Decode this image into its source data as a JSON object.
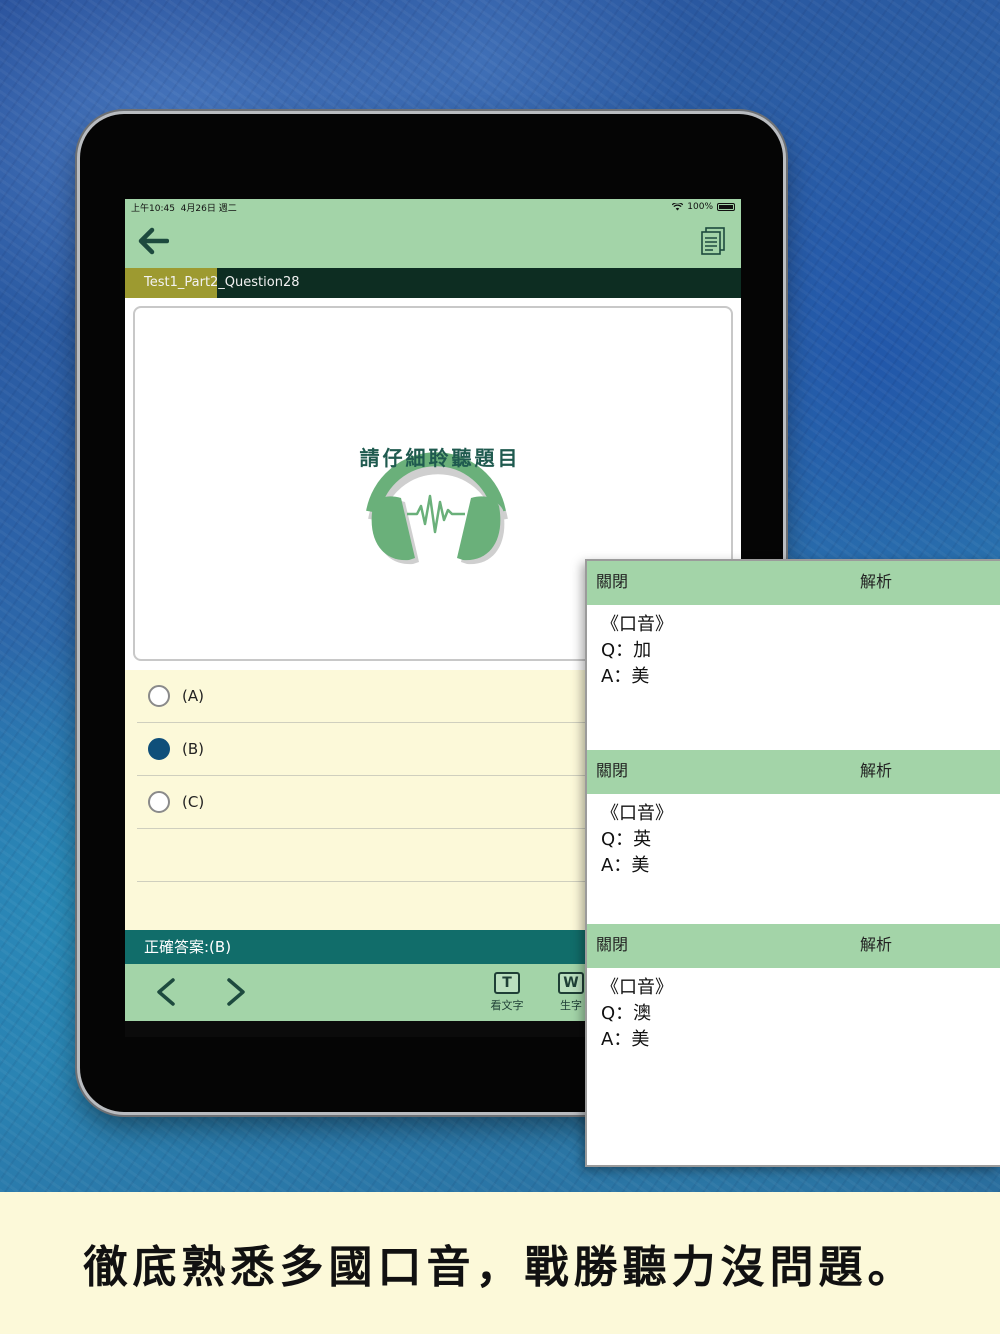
{
  "status": {
    "time": "上午10:45",
    "date": "4月26日 週二",
    "battery": "100%"
  },
  "nav": {
    "back_icon": "arrow-left-icon",
    "doc_icon": "document-list-icon"
  },
  "question": {
    "title": "Test1_Part2_Question28",
    "progress_fraction": 0.15
  },
  "listen": {
    "prompt": "請仔細聆聽題目",
    "icon": "headphones-icon"
  },
  "options": [
    {
      "label": "(A)",
      "selected": false
    },
    {
      "label": "(B)",
      "selected": true
    },
    {
      "label": "(C)",
      "selected": false
    }
  ],
  "answer": {
    "text": "正確答案:(B)"
  },
  "bottom": {
    "prev_icon": "chevron-left-icon",
    "next_icon": "chevron-right-icon",
    "tools": [
      {
        "icon_letter": "T",
        "label": "看文字"
      },
      {
        "icon_letter": "W",
        "label": "生字"
      }
    ]
  },
  "panel": {
    "sections": [
      {
        "close": "關閉",
        "title": "解析",
        "lines": [
          "《口音》",
          "Q：加",
          "A：美"
        ]
      },
      {
        "close": "關閉",
        "title": "解析",
        "lines": [
          "《口音》",
          "Q：英",
          "A：美"
        ]
      },
      {
        "close": "關閉",
        "title": "解析",
        "lines": [
          "《口音》",
          "Q：澳",
          "A：美"
        ]
      }
    ]
  },
  "caption": "徹底熟悉多國口音，戰勝聽力沒問題。",
  "colors": {
    "header_green": "#a3d4a8",
    "question_bar": "#0d2d22",
    "progress": "#9d9a30",
    "answer_bar": "#116d6a",
    "option_bg": "#fcf9d9",
    "selected_radio": "#0f4f7a"
  }
}
